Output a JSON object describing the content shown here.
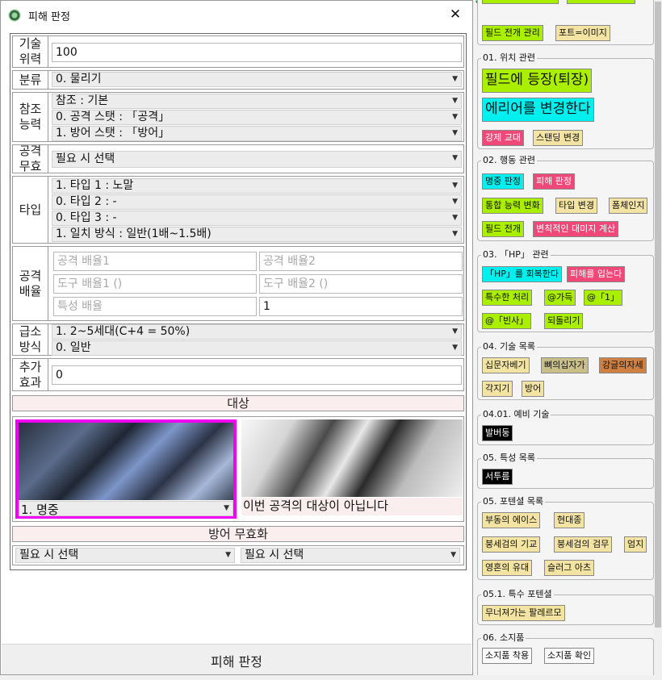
{
  "dialog": {
    "title": "피해 판정",
    "close": "✕",
    "submit_label": "피해 판정"
  },
  "form": {
    "skill_power": {
      "label": "기술\n위력",
      "value": "100"
    },
    "category": {
      "label": "분류",
      "value": "0. 물리기"
    },
    "ref_stat": {
      "label": "참조\n능력",
      "values": [
        "참조 : 기본",
        "0. 공격 스탯 : 「공격」",
        "1. 방어 스탯 : 「방어」"
      ]
    },
    "atk_nullify": {
      "label": "공격\n무효",
      "value": "필요 시 선택"
    },
    "type": {
      "label": "타입",
      "values": [
        "1. 타입 1 : 노말",
        "0. 타입 2 : -",
        "0. 타입 3 : -",
        "1. 일치 방식 : 일반(1배~1.5배)"
      ]
    },
    "atk_mult": {
      "label": "공격\n배율",
      "placeholders": [
        "공격 배율1",
        "공격 배율2",
        "도구 배율1 ()",
        "도구 배율2 ()",
        "특성 배율"
      ],
      "value": "1"
    },
    "crit": {
      "label": "급소\n방식",
      "values": [
        "1. 2~5세대(C+4 = 50%)",
        "0. 일반"
      ]
    },
    "extra": {
      "label": "추가\n효과",
      "value": "0"
    },
    "target_header": "대상",
    "targets": [
      {
        "caption": "1. 명중",
        "selected": true
      },
      {
        "caption": "이번 공격의 대상이 아닙니다",
        "selected": false
      }
    ],
    "def_nullify_header": "방어 무효화",
    "def_nullify": [
      "필요 시 선택",
      "필요 시 선택"
    ]
  },
  "right_panel": {
    "top_tags": [
      "필드 전개 관리",
      "포트=이미지"
    ],
    "sections": [
      {
        "title": "01. 위치 관련",
        "tags": [
          "필드에 등장(퇴장)",
          "에리어를 변경한다",
          "강제 교대",
          "스탠딩 변경"
        ]
      },
      {
        "title": "02. 행동 관련",
        "tags": [
          "명중 판정",
          "피해 판정",
          "통합 능력 변화",
          "타입 변경",
          "폼체인지",
          "필드 전개",
          "변칙적인 대미지 계산"
        ]
      },
      {
        "title": "03. 「HP」 관련",
        "tags": [
          "「HP」를 회복한다",
          "피해를 입는다",
          "특수한 처리",
          "@가득",
          "@「1」",
          "@「빈사」",
          "되돌리기"
        ]
      },
      {
        "title": "04. 기술 목록",
        "tags": [
          "십문자베기",
          "뼈의십자가",
          "강글의자세",
          "각지기",
          "방어"
        ]
      },
      {
        "title": "04.01. 예비 기술",
        "tags": [
          "발버둥"
        ]
      },
      {
        "title": "05. 특성 목록",
        "tags": [
          "서투름"
        ]
      },
      {
        "title": "05. 포텐셜 목록",
        "tags": [
          "부동의 에이스",
          "현대종",
          "붕세검의 기교",
          "붕세검의 검무",
          "엄지",
          "영혼의 유대",
          "슬러그 아츠"
        ]
      },
      {
        "title": "05.1. 특수 포텐셜",
        "tags": [
          "무너져가는 팔레르모"
        ]
      },
      {
        "title": "06. 소지품",
        "tags": [
          "소지품 착용",
          "소지품 확인"
        ]
      }
    ],
    "colors": {
      "lime": "#aaee00",
      "cyan": "#00f0f0",
      "pink": "#f04878",
      "pale": "#f4e4a4",
      "khaki": "#c8c088",
      "orange": "#d08040",
      "black": "#000000"
    }
  }
}
